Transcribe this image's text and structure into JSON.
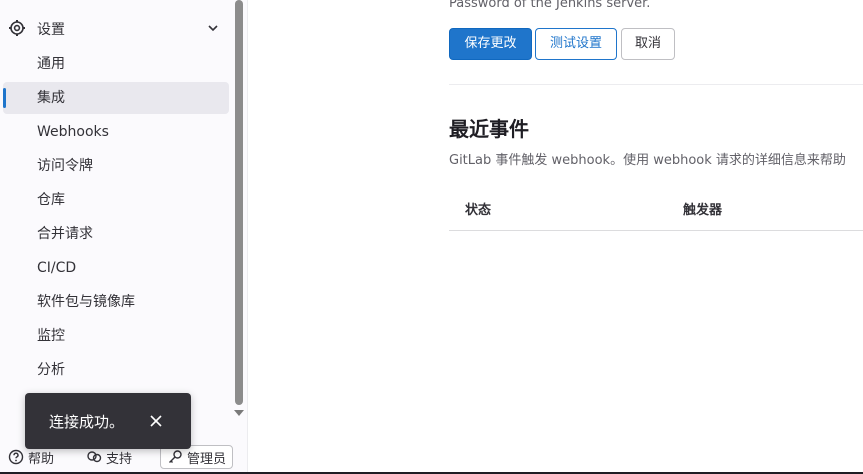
{
  "sidebar": {
    "settings_label": "设置",
    "items": [
      {
        "label": "通用",
        "active": false
      },
      {
        "label": "集成",
        "active": true
      },
      {
        "label": "Webhooks",
        "active": false
      },
      {
        "label": "访问令牌",
        "active": false
      },
      {
        "label": "仓库",
        "active": false
      },
      {
        "label": "合并请求",
        "active": false
      },
      {
        "label": "CI/CD",
        "active": false
      },
      {
        "label": "软件包与镜像库",
        "active": false
      },
      {
        "label": "监控",
        "active": false
      },
      {
        "label": "分析",
        "active": false
      }
    ],
    "bottom": {
      "help_label": "帮助",
      "support_label": "支持",
      "admin_label": "管理员"
    }
  },
  "toast": {
    "message": "连接成功。"
  },
  "main": {
    "password_help": "Password of the Jenkins server.",
    "buttons": {
      "save": "保存更改",
      "test": "测试设置",
      "cancel": "取消"
    },
    "recent_events": {
      "title": "最近事件",
      "description": "GitLab 事件触发 webhook。使用 webhook 请求的详细信息来帮助",
      "columns": [
        "状态",
        "触发器"
      ]
    }
  },
  "colors": {
    "primary": "#1f75cb",
    "toast_bg": "#333238",
    "active_bg": "#e9e8ee"
  },
  "icons": {
    "settings": "gear-icon",
    "collapse": "chevron-down-icon",
    "help": "question-icon",
    "support": "support-icon",
    "admin": "key-icon",
    "close": "close-icon"
  }
}
